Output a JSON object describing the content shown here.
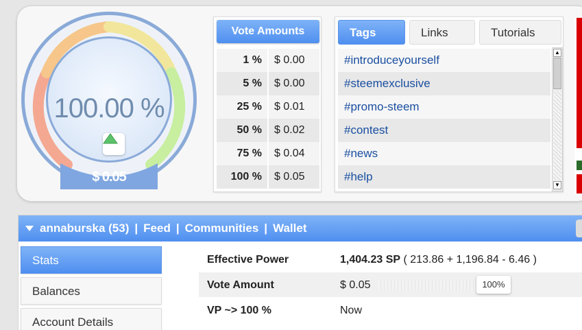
{
  "gauge": {
    "percent_text": "100.00 %",
    "value_text": "$ 0.05",
    "level": 1.0,
    "colors": {
      "red": "#f4a892",
      "orange": "#f6c68a",
      "yellow": "#f1e69c",
      "green": "#c8eea0",
      "ring": "#8aaad8",
      "pct_text": "#6f8cad"
    }
  },
  "vote_amounts": {
    "header": "Vote Amounts",
    "rows": [
      {
        "pct": "1 %",
        "amt": "$ 0.00"
      },
      {
        "pct": "5 %",
        "amt": "$ 0.00"
      },
      {
        "pct": "25 %",
        "amt": "$ 0.01"
      },
      {
        "pct": "50 %",
        "amt": "$ 0.02"
      },
      {
        "pct": "75 %",
        "amt": "$ 0.04"
      },
      {
        "pct": "100 %",
        "amt": "$ 0.05"
      }
    ]
  },
  "tags_panel": {
    "tabs": [
      {
        "label": "Tags"
      },
      {
        "label": "Links"
      },
      {
        "label": "Tutorials"
      }
    ],
    "tags": [
      "#introduceyourself",
      "#steemexclusive",
      "#promo-steem",
      "#contest",
      "#news",
      "#help"
    ]
  },
  "nav_bar": {
    "user": "annaburska (53)",
    "sep": "|",
    "links": [
      "Feed",
      "Communities",
      "Wallet"
    ]
  },
  "side_menu": {
    "items": [
      "Stats",
      "Balances",
      "Account Details"
    ]
  },
  "stats": {
    "effective_power_label": "Effective Power",
    "effective_power_value": "1,404.23 SP",
    "effective_power_breakdown": "( 213.86 + 1,196.84 - 6.46 )",
    "vote_amount_label": "Vote Amount",
    "vote_amount_value": "$ 0.05",
    "vote_amount_pct": "100%",
    "vote_amount_level": 1.0,
    "vp_label": "VP ~> 100 %",
    "vp_value": "Now"
  },
  "colors": {
    "accent": "#4f8ff0",
    "link": "#1a4fa0"
  }
}
